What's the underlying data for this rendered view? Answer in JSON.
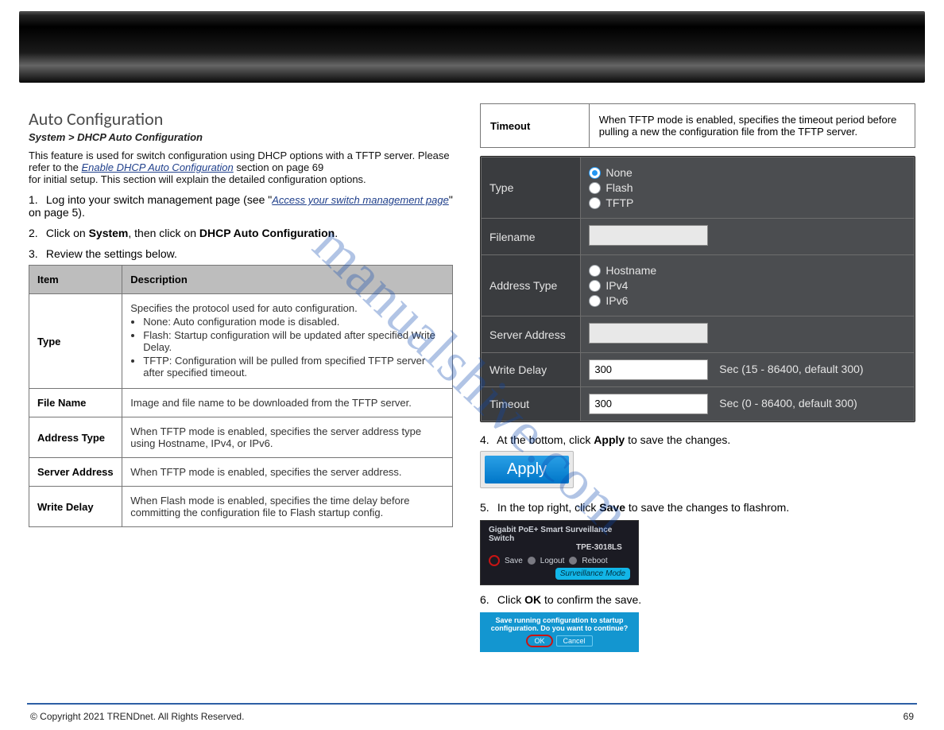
{
  "page": {
    "footer_copyright": "© Copyright 2021 TRENDnet. All Rights Reserved.",
    "footer_page": "69"
  },
  "left": {
    "section_title": "Auto Configuration",
    "crumbs": "System > DHCP Auto Configuration",
    "intro_1": "This feature is used for switch configuration using DHCP options with a TFTP server. Please refer to the",
    "intro_link": "Enable DHCP Auto Configuration",
    "intro_2": " section on page ",
    "intro_page": "69",
    "intro_3": "for initial setup. This section will explain the detailed configuration options.",
    "step1a": "Log into your switch management page (see \"",
    "step1b": "Access your switch management page",
    "step1c": "\" on page 5).",
    "step2a": "Click on ",
    "step2b_sys": "System",
    "step2c": ", then click on ",
    "step2b_dhcp": "DHCP Auto Configuration",
    "step2d": ".",
    "step3": "Review the settings below.",
    "table": {
      "h1": "Item",
      "h2": "Description",
      "rows": [
        {
          "k": "Type",
          "v": [
            "Specifies the protocol used for auto configuration.",
            "None: Auto configuration mode is disabled.",
            "Flash: Startup configuration will be updated after specified Write Delay.",
            "TFTP: Configuration will be pulled from specified TFTP server after specified timeout."
          ]
        },
        {
          "k": "File Name",
          "v": [
            "Image and file name to be downloaded from the TFTP server."
          ]
        },
        {
          "k": "Address Type",
          "v": [
            "When TFTP mode is enabled, specifies the server address type using Hostname, IPv4, or IPv6."
          ]
        },
        {
          "k": "Server Address",
          "v": [
            "When TFTP mode is enabled, specifies the server address."
          ]
        },
        {
          "k": "Write Delay",
          "v": [
            "When Flash mode is enabled, specifies the time delay before committing the configuration file to Flash startup config."
          ]
        }
      ]
    }
  },
  "right": {
    "top_row": {
      "k": "Timeout",
      "v": "When TFTP mode is enabled, specifies the timeout period before pulling a new the configuration file from the TFTP server."
    },
    "panel": {
      "rows": {
        "type_label": "Type",
        "type_opts": [
          "None",
          "Flash",
          "TFTP"
        ],
        "filename_label": "Filename",
        "addr_label": "Address Type",
        "addr_opts": [
          "Hostname",
          "IPv4",
          "IPv6"
        ],
        "server_label": "Server Address",
        "write_label": "Write Delay",
        "write_val": "300",
        "write_note": "Sec (15 - 86400, default 300)",
        "timeout_label": "Timeout",
        "timeout_val": "300",
        "timeout_note": "Sec (0 - 86400, default 300)"
      }
    },
    "step4a": "At the bottom, click ",
    "step4b": "Apply",
    "step4c": " to save the changes.",
    "apply_label": "Apply",
    "step5a": "In the top right, click ",
    "step5b": "Save",
    "step5c": " to save the changes to flashrom.",
    "sv": {
      "ln1": "Gigabit PoE+ Smart Surveillance Switch",
      "ln2": "TPE-3018LS",
      "b1": "Save",
      "b2": "Logout",
      "b3": "Reboot",
      "mode": "Surveillance Mode"
    },
    "step6a": "Click ",
    "step6b": "OK",
    "step6c": " to confirm the save.",
    "confirm": {
      "q": "Save running configuration to startup configuration. Do you want to continue?",
      "ok": "OK",
      "cancel": "Cancel"
    }
  },
  "watermark": "manualshive.com"
}
